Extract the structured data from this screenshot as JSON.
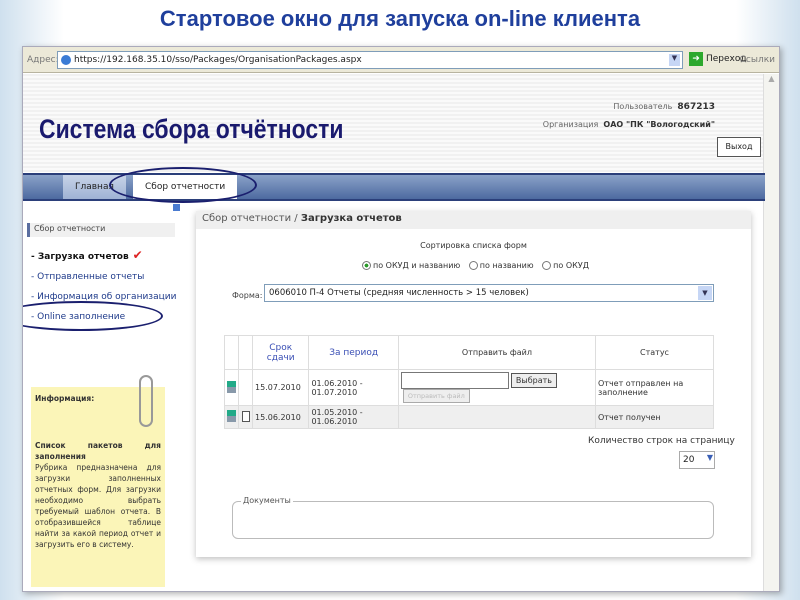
{
  "slide_title": "Стартовое окно для запуска on-line клиента",
  "browser": {
    "address_label": "Адрес:",
    "url": "https://192.168.35.10/sso/Packages/OrganisationPackages.aspx",
    "go_label": "Переход",
    "links_label": "Ссылки"
  },
  "header": {
    "system_title": "Система сбора отчётности",
    "user_label": "Пользователь",
    "user_value": "867213",
    "org_label": "Организация",
    "org_value": "ОАО \"ПК \"Вологодский\"",
    "logout_label": "Выход"
  },
  "nav": {
    "tabs": [
      {
        "label": "Главная"
      },
      {
        "label": "Сбор отчетности"
      }
    ]
  },
  "sidebar": {
    "heading": "Сбор отчетности",
    "items": [
      {
        "label": "- Загрузка отчетов"
      },
      {
        "label": "- Отправленные отчеты"
      },
      {
        "label": "- Информация об организации"
      },
      {
        "label": "- Online заполнение"
      }
    ]
  },
  "info": {
    "title": "Информация:",
    "subtitle": "Список пакетов для заполнения",
    "text": "Рубрика предназначена для загрузки заполненных отчетных форм. Для загрузки необходимо выбрать требуемый шаблон отчета. В отобразившейся таблице найти за какой период отчет и загрузить его в систему."
  },
  "main": {
    "breadcrumb_parent": "Сбор отчетности /",
    "breadcrumb_current": "Загрузка отчетов",
    "sort_label": "Сортировка списка форм",
    "sort_options": [
      {
        "label": "по ОКУД и названию",
        "selected": true
      },
      {
        "label": "по названию",
        "selected": false
      },
      {
        "label": "по ОКУД",
        "selected": false
      }
    ],
    "form_label": "Форма:",
    "form_value": "0606010 П-4 Отчеты (средняя численность > 15 человек)",
    "table": {
      "headers": [
        "Срок сдачи",
        "За период",
        "Отправить файл",
        "Статус"
      ],
      "rows": [
        {
          "deadline": "15.07.2010",
          "period": "01.06.2010 - 01.07.2010",
          "choose_label": "Выбрать",
          "send_label": "Отправить файл",
          "status": "Отчет отправлен на заполнение"
        },
        {
          "deadline": "15.06.2010",
          "period": "01.05.2010 - 01.06.2010",
          "status": "Отчет получен"
        }
      ]
    },
    "rows_per_page_label": "Количество строк на страницу",
    "rows_per_page": "20",
    "documents_label": "Документы"
  }
}
